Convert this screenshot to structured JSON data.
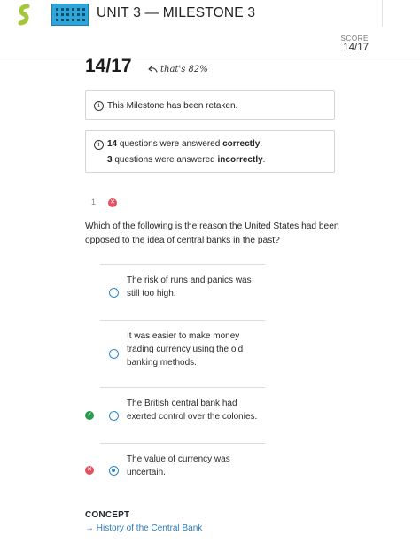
{
  "header": {
    "title": "UNIT 3 — MILESTONE 3",
    "logo_icon": "sophia-logo-icon",
    "course_thumb_icon": "course-thumbnail-icon",
    "accent_color": "#a4c639"
  },
  "score": {
    "label": "SCORE",
    "value": "14/17",
    "big": "14/17",
    "percent_note": "that's 82%"
  },
  "notices": {
    "retaken": "This Milestone has been retaken.",
    "correct_count": "14",
    "correct_text": " questions were answered ",
    "correct_word": "correctly",
    "incorrect_count": "3",
    "incorrect_text": " questions were answered ",
    "incorrect_word": "incorrectly"
  },
  "question": {
    "number": "1",
    "status": "incorrect",
    "text": "Which of the following is the reason the United States had been opposed to the idea of central banks in the past?",
    "options": [
      {
        "text": "The risk of runs and panics was still too high.",
        "selected": false,
        "mark": ""
      },
      {
        "text": "It was easier to make money trading currency using the old banking methods.",
        "selected": false,
        "mark": ""
      },
      {
        "text": "The British central bank had exerted control over the colonies.",
        "selected": false,
        "mark": "correct"
      },
      {
        "text": "The value of currency was uncertain.",
        "selected": true,
        "mark": "incorrect"
      }
    ]
  },
  "concept": {
    "label": "CONCEPT",
    "link_arrow": "→",
    "link_text": "History of the Central Bank"
  },
  "colors": {
    "link": "#2a7bbf",
    "radio": "#2a88c9",
    "correct": "#2a9a4e",
    "incorrect": "#e05262"
  }
}
